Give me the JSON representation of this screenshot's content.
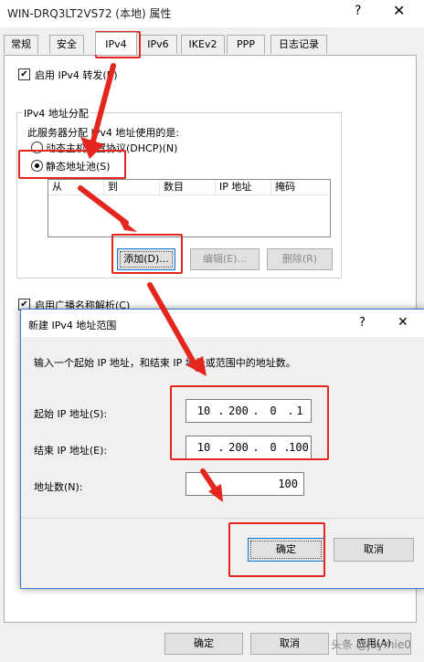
{
  "window": {
    "title": "WIN-DRQ3LT2VS72 (本地) 属性",
    "help_glyph": "?",
    "close_glyph": "✕"
  },
  "tabs": [
    {
      "label": "常规"
    },
    {
      "label": "安全"
    },
    {
      "label": "IPv4"
    },
    {
      "label": "IPv6"
    },
    {
      "label": "IKEv2"
    },
    {
      "label": "PPP"
    },
    {
      "label": "日志记录"
    }
  ],
  "ipv4": {
    "enable_forwarding_label": "启用 IPv4 转发(B)",
    "enable_forwarding_checked": true,
    "group_title": "IPv4 地址分配",
    "group_desc": "此服务器分配 IPv4 地址使用的是:",
    "dhcp_label": "动态主机配置协议(DHCP)(N)",
    "static_pool_label": "静态地址池(S)",
    "selected": "static_pool",
    "table_columns": [
      "从",
      "到",
      "数目",
      "IP 地址",
      "掩码"
    ],
    "add_button": "添加(D)...",
    "edit_button": "编辑(E)...",
    "delete_button": "删除(R)",
    "broadcast_label": "启用广播名称解析(C)",
    "broadcast_checked": true
  },
  "dialog": {
    "title": "新建 IPv4 地址范围",
    "help_glyph": "?",
    "close_glyph": "✕",
    "instruction": "输入一个起始 IP 地址，和结束 IP 地址或范围中的地址数。",
    "start_label": "起始 IP 地址(S):",
    "start_ip": [
      "10",
      "200",
      "0",
      "1"
    ],
    "end_label": "结束 IP 地址(E):",
    "end_ip": [
      "10",
      "200",
      "0",
      "100"
    ],
    "count_label": "地址数(N):",
    "count_value": "100",
    "ok_button": "确定",
    "cancel_button": "取消"
  },
  "footer": {
    "ok_button": "确定",
    "cancel_button": "取消",
    "apply_button": "应用(A)"
  },
  "watermark": "头条 @Jaymie0",
  "colors": {
    "annotation_red": "#e5261f",
    "dialog_border": "#3c78c8",
    "default_button_border": "#0078d7"
  }
}
